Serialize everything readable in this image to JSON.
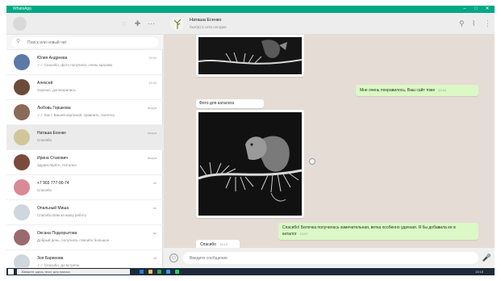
{
  "window": {
    "title": "WhatsApp"
  },
  "search": {
    "placeholder": "Поиск или новый чат"
  },
  "chats": [
    {
      "name": "Юлия Андреева",
      "preview": "✓✓ Спасибо, фото получила, очень красиво",
      "time": "13:54",
      "avatar_color": "#5b7aa6"
    },
    {
      "name": "Алексей",
      "preview": "Хорошо, договорились",
      "time": "13:40",
      "avatar_color": "#6b4b3a"
    },
    {
      "name": "Любовь Горшкова",
      "preview": "✓✓ Как с Вашей картиной, сравнить, понятно",
      "time": "вчера",
      "avatar_color": "#8a6a58"
    },
    {
      "name": "Наташа Есенко",
      "preview": "Спасибо",
      "time": "вчера",
      "avatar_color": "#cfc79a"
    },
    {
      "name": "Ирина Стахович",
      "preview": "Здравствуйте, Наталья",
      "time": "вчера",
      "avatar_color": "#7a4b3c"
    },
    {
      "name": "+7 903 777-00-74",
      "preview": "Спасибо",
      "time": "пн",
      "avatar_color": "#d88a95"
    },
    {
      "name": "Опальный Миша",
      "preview": "Спасибо Вам за вашу работу",
      "time": "пн",
      "avatar_color": "#cfd6dc"
    },
    {
      "name": "Оксана Подкорытова",
      "preview": "Добрый день, получила, спасибо большое",
      "time": "вс",
      "avatar_color": "#9a6a6e"
    },
    {
      "name": "Зоя Баринова",
      "preview": "✓✓ Спасибо, до встречи",
      "time": "сб",
      "avatar_color": "#cfd6dc"
    },
    {
      "name": "+7 911 088-48-40",
      "preview": "✓✓ Наталья, здравствуйте",
      "time": "пт",
      "avatar_color": "#33405a"
    }
  ],
  "conversation": {
    "contact_name": "Наташа Есенко",
    "status": "был(а) в сети сегодня",
    "messages": {
      "out1": {
        "text": "Мне очень понравилось, Ваш сайт тоже",
        "time": "13:01"
      },
      "caption_chip": "Фото для каталога",
      "out2": {
        "text": "Спасибо! Белочка получилась замечательная, ветка особенно удачная. Я бы добавила ее в каталог",
        "time": "13:07"
      },
      "in_last": {
        "text": "Спасибо",
        "time": "13:12"
      }
    },
    "composer_placeholder": "Введите сообщение"
  },
  "taskbar": {
    "search_placeholder": "Введите здесь текст для поиска",
    "clock": "13:15"
  },
  "colors": {
    "accent": "#00a884",
    "outgoing": "#dcf8c6",
    "chat_bg": "#e5ddd5"
  }
}
